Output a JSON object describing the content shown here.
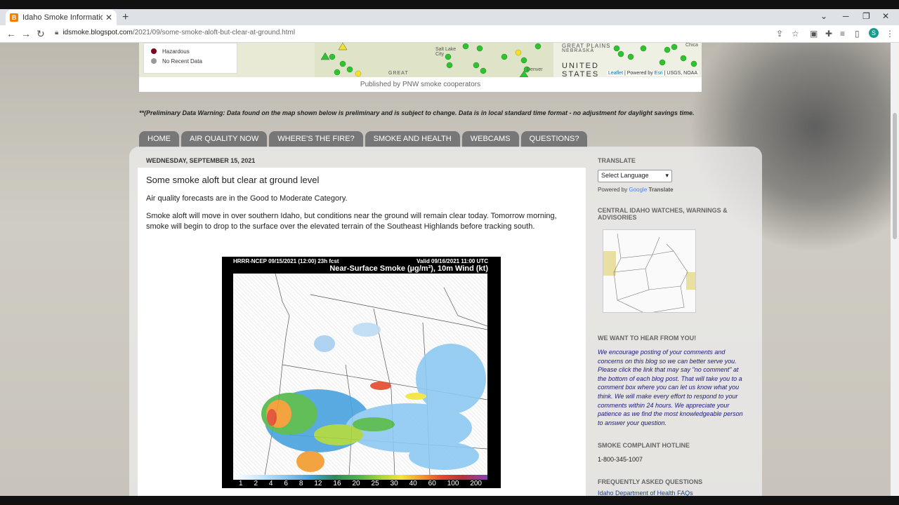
{
  "browser": {
    "tab_title": "Idaho Smoke Information: Some",
    "favicon": "B",
    "url_host": "idsmoke.blogspot.com",
    "url_path": "/2021/09/some-smoke-aloft-but-clear-at-ground.html",
    "profile_initial": "S"
  },
  "map": {
    "legend": [
      {
        "label": "Hazardous",
        "color": "#7e0023"
      },
      {
        "label": "No Recent Data",
        "color": "#999999"
      }
    ],
    "labels": {
      "great_plains": "GREAT PLAINS",
      "nebraska": "NEBRASKA",
      "united_states": "UNITED STATES",
      "salt_lake": "Salt Lake City",
      "denver": "Denver",
      "great": "GREAT",
      "chicago": "Chica"
    },
    "attribution_leaflet": "Leaflet",
    "attribution_rest": " | Powered by ",
    "attribution_esri": "Esri",
    "attribution_tail": " | USGS, NOAA",
    "published": "Published by PNW smoke cooperators"
  },
  "warning": "**(Preliminary Data Warning: Data found on the map shown below is preliminary and is subject to change. Data is in local standard time format - no adjustment for daylight savings time.",
  "nav": [
    "HOME",
    "AIR QUALITY NOW",
    "WHERE'S THE FIRE?",
    "SMOKE AND HEALTH",
    "WEBCAMS",
    "QUESTIONS?"
  ],
  "post": {
    "date": "WEDNESDAY, SEPTEMBER 15, 2021",
    "title": "Some smoke aloft but clear at ground level",
    "p1": "Air quality forecasts are in the Good to Moderate Category.",
    "p2": "Smoke aloft will move in over southern Idaho, but conditions near the ground will remain clear today. Tomorrow morning, smoke will begin to drop to the surface over the elevated terrain of the Southeast Highlands before tracking south.",
    "image": {
      "header_left": "HRRR-NCEP 09/15/2021 (12:00) 23h fcst",
      "header_right": "Valid 09/16/2021 11:00 UTC",
      "title": "Near-Surface Smoke (µg/m³), 10m Wind (kt)",
      "scale": [
        "1",
        "2",
        "4",
        "6",
        "8",
        "12",
        "16",
        "20",
        "25",
        "30",
        "40",
        "60",
        "100",
        "200"
      ]
    }
  },
  "sidebar": {
    "translate_heading": "TRANSLATE",
    "translate_select": "Select Language",
    "powered_by": "Powered by ",
    "google": "Google",
    "translate_word": "Translate",
    "watches_heading": "CENTRAL IDAHO WATCHES, WARNINGS & ADVISORIES",
    "hear_heading": "WE WANT TO HEAR FROM YOU!",
    "hear_text": "We encourage posting of your comments and concerns on this blog so we can better serve you. Please click the link that may say \"no comment\" at the bottom of each blog post. That will take you to a comment box where you can let us know what you think. We will make every effort to respond to your comments within 24 hours. We appreciate your patience as we find the most knowledgeable person to answer your question.",
    "hotline_heading": "SMOKE COMPLAINT HOTLINE",
    "hotline": "1-800-345-1007",
    "faq_heading": "FREQUENTLY ASKED QUESTIONS",
    "faq_link": "Idaho Department of Health FAQs"
  }
}
